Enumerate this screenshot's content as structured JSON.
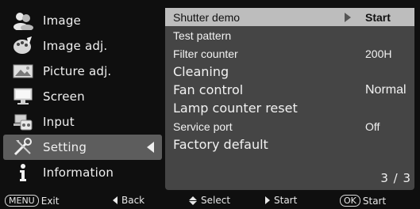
{
  "left_menu": {
    "items": [
      {
        "label": "Image",
        "icon": "people-icon"
      },
      {
        "label": "Image adj.",
        "icon": "palette-icon"
      },
      {
        "label": "Picture adj.",
        "icon": "picture-icon"
      },
      {
        "label": "Screen",
        "icon": "screen-icon"
      },
      {
        "label": "Input",
        "icon": "input-icon"
      },
      {
        "label": "Setting",
        "icon": "tools-icon",
        "active": true
      },
      {
        "label": "Information",
        "icon": "info-icon"
      }
    ]
  },
  "right_panel": {
    "rows": [
      {
        "label": "Shutter demo",
        "value": "Start"
      },
      {
        "label": "Test pattern",
        "value": ""
      },
      {
        "label": "Filter counter",
        "value": "200H"
      },
      {
        "label": "Cleaning",
        "value": ""
      },
      {
        "label": "Fan control",
        "value": "Normal"
      },
      {
        "label": "Lamp counter reset",
        "value": ""
      },
      {
        "label": "Service port",
        "value": "Off"
      },
      {
        "label": "Factory default",
        "value": ""
      }
    ],
    "page_indicator": "3 / 3"
  },
  "bottom_bar": {
    "exit_key": "MENU",
    "exit_label": "Exit",
    "back_label": "Back",
    "select_label": "Select",
    "start_label": "Start",
    "ok_key": "OK",
    "ok_start_label": "Start"
  },
  "colors": {
    "background": "#0f0f0f",
    "panel": "#454545",
    "selected_row": "#bdbdbd",
    "active_menu": "#5d5d5d"
  }
}
